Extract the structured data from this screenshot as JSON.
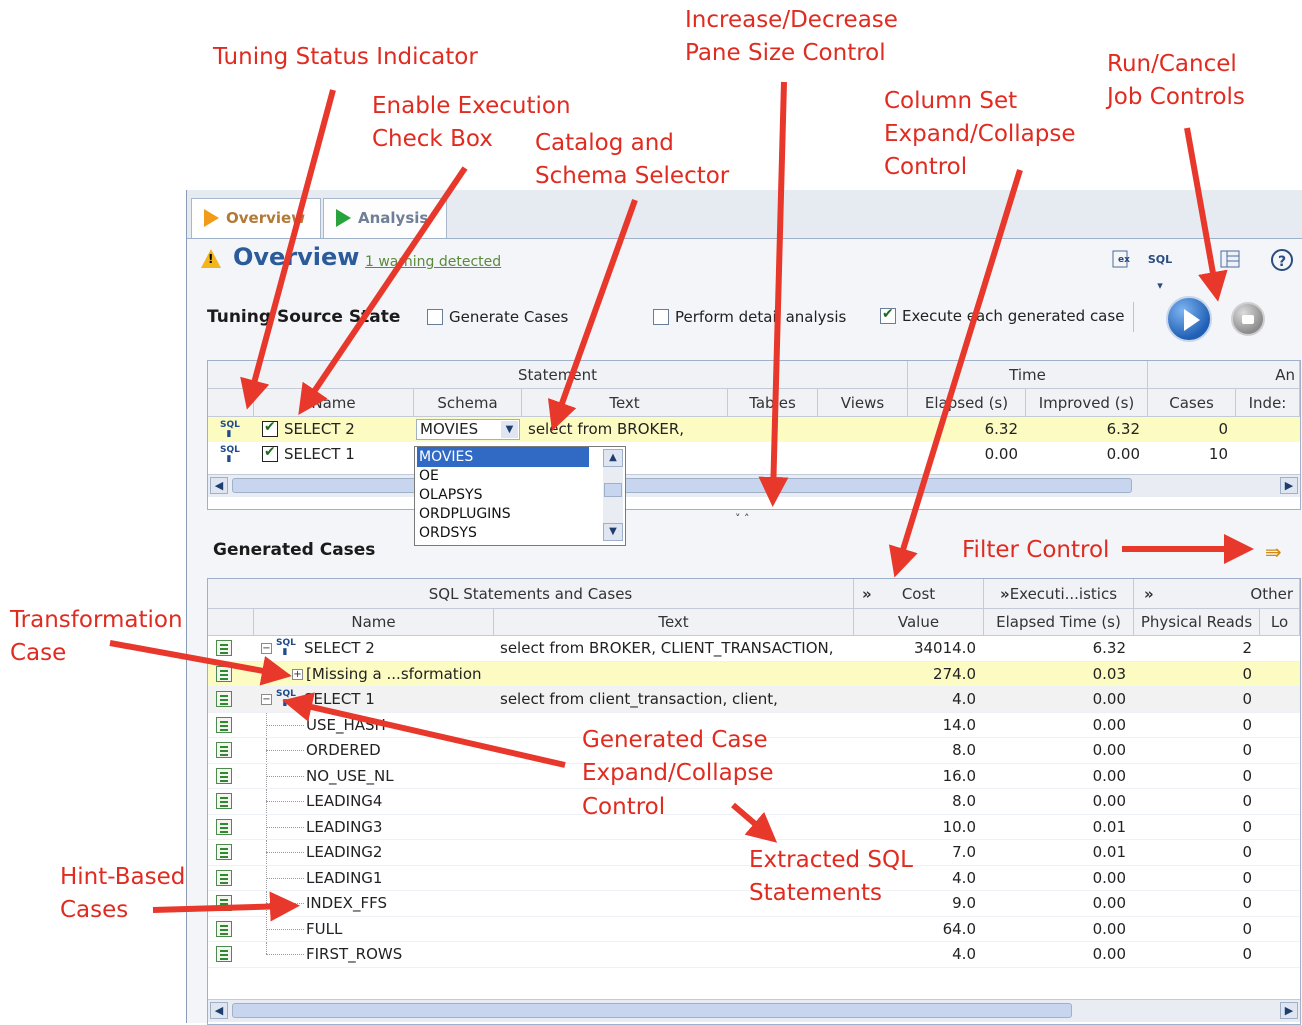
{
  "callouts": {
    "tuning_status": "Tuning Status Indicator",
    "enable_execution": [
      "Enable Execution",
      "Check Box"
    ],
    "catalog_schema": [
      "Catalog and",
      "Schema Selector"
    ],
    "pane_size": [
      "Increase/Decrease",
      "Pane Size Control"
    ],
    "column_set": [
      "Column Set",
      "Expand/Collapse",
      "Control"
    ],
    "run_cancel": [
      "Run/Cancel",
      "Job Controls"
    ],
    "filter_control": "Filter Control",
    "transformation_case": [
      "Transformation",
      "Case"
    ],
    "generated_case": [
      "Generated Case",
      "Expand/Collapse",
      "Control"
    ],
    "extracted_sql": [
      "Extracted SQL",
      "Statements"
    ],
    "hint_based": [
      "Hint-Based",
      "Cases"
    ]
  },
  "tabs": [
    {
      "label": "Overview",
      "active": true
    },
    {
      "label": "Analysis",
      "active": false
    }
  ],
  "header": {
    "title": "Overview",
    "warning_link": "1 warning detected",
    "toolbar_sql": "SQL"
  },
  "source": {
    "label": "Tuning Source State",
    "options": [
      {
        "label": "Generate Cases",
        "checked": false
      },
      {
        "label": "Perform detail analysis",
        "checked": false
      },
      {
        "label": "Execute each generated case",
        "checked": true
      }
    ]
  },
  "statements": {
    "group_headers": {
      "statement": "Statement",
      "time": "Time",
      "an": "An"
    },
    "columns": [
      "Name",
      "Schema",
      "Text",
      "Tables",
      "Views",
      "Elapsed (s)",
      "Improved (s)",
      "Cases",
      "Inde:"
    ],
    "rows": [
      {
        "icon": "SQL",
        "checked": true,
        "name": "SELECT 2",
        "schema": "MOVIES",
        "text": "select from BROKER,",
        "elapsed": "6.32",
        "improved": "6.32",
        "cases": "0"
      },
      {
        "icon": "SQL",
        "checked": true,
        "name": "SELECT 1",
        "schema": "",
        "text": "",
        "elapsed": "0.00",
        "improved": "0.00",
        "cases": "10"
      }
    ],
    "schema_options": [
      "MOVIES",
      "OE",
      "OLAPSYS",
      "ORDPLUGINS",
      "ORDSYS"
    ]
  },
  "pane_control": "˅ ˄",
  "generated": {
    "label": "Generated Cases",
    "group_headers": {
      "sql": "SQL Statements and Cases",
      "cost": "Cost",
      "exec": "Executi...istics",
      "other": "Other",
      "expand": "»"
    },
    "columns": [
      "Name",
      "Text",
      "Value",
      "Elapsed Time (s)",
      "Physical Reads",
      "Lo"
    ],
    "rows": [
      {
        "name": "SELECT 2",
        "text": "select from BROKER, CLIENT_TRANSACTION,",
        "value": "34014.0",
        "elapsed": "6.32",
        "reads": "2",
        "level": 0,
        "kind": "stmt",
        "highlight": "none"
      },
      {
        "name": "[Missing a ...sformation",
        "text": "",
        "value": "274.0",
        "elapsed": "0.03",
        "reads": "0",
        "level": 1,
        "kind": "transform",
        "highlight": "yellow"
      },
      {
        "name": "SELECT 1",
        "text": "select from client_transaction, client,",
        "value": "4.0",
        "elapsed": "0.00",
        "reads": "0",
        "level": 0,
        "kind": "stmt",
        "highlight": "gray"
      },
      {
        "name": "USE_HASH",
        "text": "",
        "value": "14.0",
        "elapsed": "0.00",
        "reads": "0",
        "level": 1,
        "kind": "hint",
        "highlight": "none"
      },
      {
        "name": "ORDERED",
        "text": "",
        "value": "8.0",
        "elapsed": "0.00",
        "reads": "0",
        "level": 1,
        "kind": "hint",
        "highlight": "none"
      },
      {
        "name": "NO_USE_NL",
        "text": "",
        "value": "16.0",
        "elapsed": "0.00",
        "reads": "0",
        "level": 1,
        "kind": "hint",
        "highlight": "none"
      },
      {
        "name": "LEADING4",
        "text": "",
        "value": "8.0",
        "elapsed": "0.00",
        "reads": "0",
        "level": 1,
        "kind": "hint",
        "highlight": "none"
      },
      {
        "name": "LEADING3",
        "text": "",
        "value": "10.0",
        "elapsed": "0.01",
        "reads": "0",
        "level": 1,
        "kind": "hint",
        "highlight": "none"
      },
      {
        "name": "LEADING2",
        "text": "",
        "value": "7.0",
        "elapsed": "0.01",
        "reads": "0",
        "level": 1,
        "kind": "hint",
        "highlight": "none"
      },
      {
        "name": "LEADING1",
        "text": "",
        "value": "4.0",
        "elapsed": "0.00",
        "reads": "0",
        "level": 1,
        "kind": "hint",
        "highlight": "none"
      },
      {
        "name": "INDEX_FFS",
        "text": "",
        "value": "9.0",
        "elapsed": "0.00",
        "reads": "0",
        "level": 1,
        "kind": "hint",
        "highlight": "none"
      },
      {
        "name": "FULL",
        "text": "",
        "value": "64.0",
        "elapsed": "0.00",
        "reads": "0",
        "level": 1,
        "kind": "hint",
        "highlight": "none"
      },
      {
        "name": "FIRST_ROWS",
        "text": "",
        "value": "4.0",
        "elapsed": "0.00",
        "reads": "0",
        "level": 1,
        "kind": "hint",
        "highlight": "none"
      }
    ]
  },
  "colors": {
    "annotation": "#e02b20",
    "title": "#2b5b9a",
    "row_highlight": "#fbfbc2",
    "selection": "#316ac5"
  }
}
